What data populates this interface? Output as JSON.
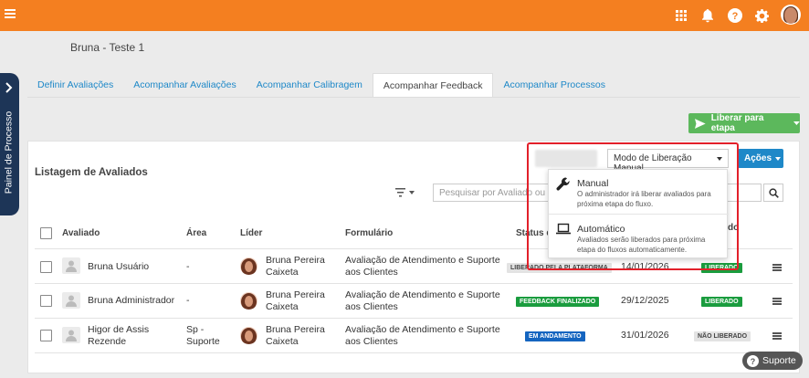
{
  "header": {
    "bg_color": "#f47f20"
  },
  "page": {
    "title": "Bruna - Teste 1"
  },
  "side_panel": {
    "label": "Painel de Processo"
  },
  "tabs": [
    {
      "label": "Definir Avaliações"
    },
    {
      "label": "Acompanhar Avaliações"
    },
    {
      "label": "Acompanhar Calibragem"
    },
    {
      "label": "Acompanhar Feedback",
      "active": true
    },
    {
      "label": "Acompanhar Processos"
    }
  ],
  "toolbar": {
    "release_stage_label": "Liberar para etapa",
    "actions_label": "Ações",
    "mode_label": "Modo de Liberação Manual"
  },
  "list": {
    "title": "Listagem de Avaliados",
    "search_placeholder": "Pesquisar por Avaliado ou Líder"
  },
  "dropdown": {
    "items": [
      {
        "icon": "wrench-icon",
        "title": "Manual",
        "description": "O administrador irá liberar avaliados para próxima etapa do fluxo."
      },
      {
        "icon": "laptop-icon",
        "title": "Automático",
        "description": "Avaliados serão liberados para próxima etapa do fluxos automaticamente."
      }
    ]
  },
  "table": {
    "columns": {
      "evaluated": "Avaliado",
      "area": "Área",
      "leader": "Líder",
      "form": "Formulário",
      "status": "Status d",
      "release": "do"
    },
    "rows": [
      {
        "name": "Bruna Usuário",
        "area": "-",
        "leader": "Bruna Pereira Caixeta",
        "form": "Avaliação de Atendimento e Suporte aos Clientes",
        "status": "LIBERADO PELA PLATAFORMA",
        "date": "14/01/2026",
        "release": "LIBERADO"
      },
      {
        "name": "Bruna Administrador",
        "area": "-",
        "leader": "Bruna Pereira Caixeta",
        "form": "Avaliação de Atendimento e Suporte aos Clientes",
        "status": "FEEDBACK FINALIZADO",
        "date": "29/12/2025",
        "release": "LIBERADO"
      },
      {
        "name": "Higor de Assis Rezende",
        "area": "Sp - Suporte",
        "leader": "Bruna Pereira Caixeta",
        "form": "Avaliação de Atendimento e Suporte aos Clientes",
        "status": "EM ANDAMENTO",
        "date": "31/01/2026",
        "release": "NÃO LIBERADO"
      }
    ]
  },
  "support": {
    "label": "Suporte"
  },
  "colors": {
    "primary": "#f47f20",
    "accent": "#1e88c8",
    "success": "#5cb85c",
    "highlight": "#e2202a",
    "side": "#1d3557"
  }
}
